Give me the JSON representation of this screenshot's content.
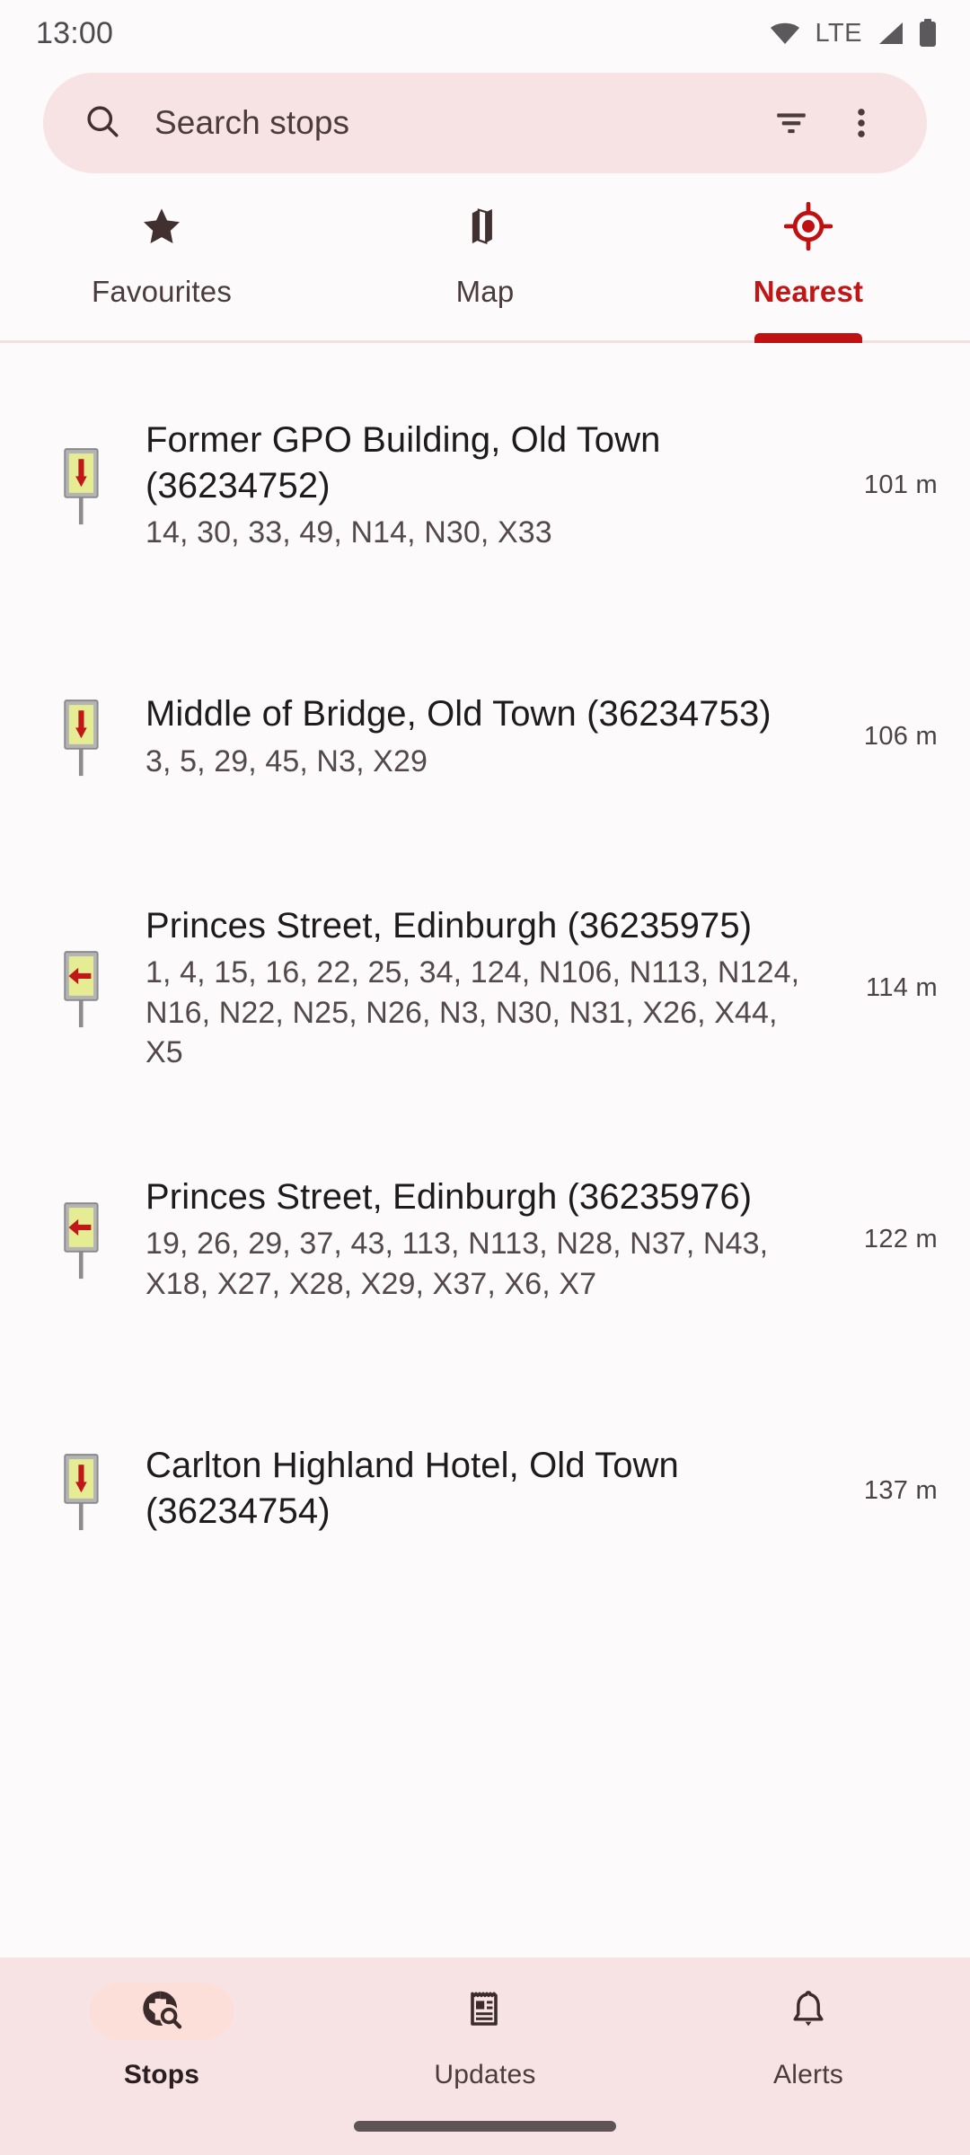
{
  "status_bar": {
    "clock": "13:00",
    "network_label": "LTE",
    "icons": [
      "wifi-icon",
      "signal-icon",
      "battery-icon"
    ]
  },
  "search": {
    "placeholder": "Search stops",
    "value": "",
    "search_icon": "search-icon",
    "filter_icon": "filter-list-icon",
    "overflow_icon": "more-vert-icon"
  },
  "tabs": [
    {
      "label": "Favourites",
      "icon": "star-icon",
      "active": false
    },
    {
      "label": "Map",
      "icon": "map-icon",
      "active": false
    },
    {
      "label": "Nearest",
      "icon": "my-location-icon",
      "active": true
    }
  ],
  "colors": {
    "accent_red": "#bf1111",
    "tab_active_text": "#c11616",
    "search_bg": "#f8e3e4",
    "page_bg": "#fdfafc",
    "nav_bg": "#f8e3e4",
    "nav_pill": "#fcdfd9",
    "sign_fill": "#e5ec93",
    "sign_border": "#9c9c9c",
    "arrow_red": "#c01818"
  },
  "stops": [
    {
      "name": "Former GPO Building, Old Town (36234752)",
      "routes": "14, 30, 33, 49, N14, N30, X33",
      "distance": "101 m",
      "icon": "bus-stop-sign-down-arrow-icon"
    },
    {
      "name": "Middle of Bridge, Old Town (36234753)",
      "routes": "3, 5, 29, 45, N3, X29",
      "distance": "106 m",
      "icon": "bus-stop-sign-down-arrow-icon"
    },
    {
      "name": "Princes Street, Edinburgh (36235975)",
      "routes": "1, 4, 15, 16, 22, 25, 34, 124, N106, N113, N124, N16, N22, N25, N26, N3, N30, N31, X26, X44, X5",
      "distance": "114 m",
      "icon": "bus-stop-sign-left-arrow-icon"
    },
    {
      "name": "Princes Street, Edinburgh (36235976)",
      "routes": "19, 26, 29, 37, 43, 113, N113, N28, N37, N43, X18, X27, X28, X29, X37, X6, X7",
      "distance": "122 m",
      "icon": "bus-stop-sign-left-arrow-icon"
    },
    {
      "name": "Carlton Highland Hotel, Old Town (36234754)",
      "routes": "",
      "distance": "137 m",
      "icon": "bus-stop-sign-down-arrow-icon"
    }
  ],
  "bottom_nav": [
    {
      "label": "Stops",
      "icon": "travel-explore-icon",
      "active": true
    },
    {
      "label": "Updates",
      "icon": "newspaper-icon",
      "active": false
    },
    {
      "label": "Alerts",
      "icon": "notifications-bell-icon",
      "active": false
    }
  ]
}
